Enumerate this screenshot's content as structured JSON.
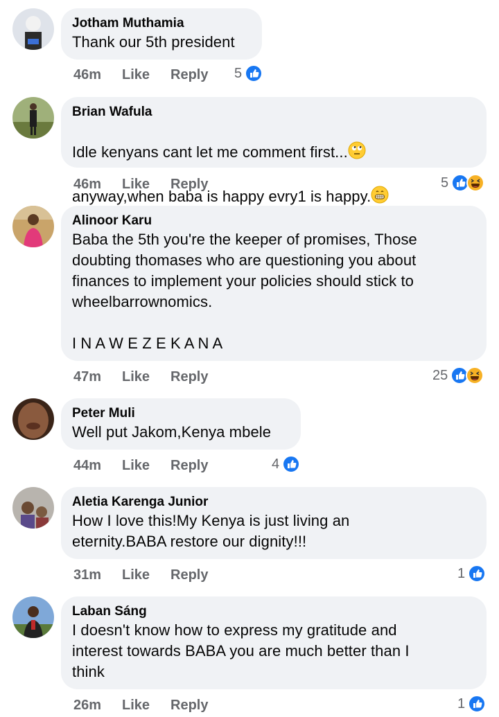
{
  "comments": [
    {
      "author": "Jotham Muthamia",
      "text": "Thank our 5th president",
      "time": "46m",
      "like_label": "Like",
      "reply_label": "Reply",
      "reactions": {
        "count": "5",
        "types": [
          "like"
        ]
      }
    },
    {
      "author": "Brian Wafula",
      "text_line1": "Idle kenyans cant let me comment first...",
      "text_line2": "anyway,when baba is happy evry1 is happy.",
      "emoji1": "face-with-rolling-eyes-icon",
      "emoji2": "grinning-face-icon",
      "time": "46m",
      "like_label": "Like",
      "reply_label": "Reply",
      "reactions": {
        "count": "5",
        "types": [
          "like",
          "haha"
        ]
      }
    },
    {
      "author": "Alinoor Karu",
      "text": "Baba the 5th you're the keeper of promises, Those\ndoubting thomases who are questioning you about\nfinances to implement your policies should stick to\nwheelbarrownomics.\n\nI N A W E Z E K A N A",
      "time": "47m",
      "like_label": "Like",
      "reply_label": "Reply",
      "reactions": {
        "count": "25",
        "types": [
          "like",
          "haha"
        ]
      }
    },
    {
      "author": "Peter Muli",
      "text": "Well put Jakom,Kenya mbele",
      "time": "44m",
      "like_label": "Like",
      "reply_label": "Reply",
      "reactions": {
        "count": "4",
        "types": [
          "like"
        ]
      }
    },
    {
      "author": "Aletia Karenga Junior",
      "text": "How I love this!My Kenya is just living an\neternity.BABA restore our dignity!!!",
      "time": "31m",
      "like_label": "Like",
      "reply_label": "Reply",
      "reactions": {
        "count": "1",
        "types": [
          "like"
        ]
      }
    },
    {
      "author": "Laban Sáng",
      "text": "I doesn't know how to express my gratitude and\ninterest towards BABA you are much better than I\nthink",
      "time": "26m",
      "like_label": "Like",
      "reply_label": "Reply",
      "reactions": {
        "count": "1",
        "types": [
          "like"
        ]
      }
    }
  ],
  "colors": {
    "like_blue": "#1877f2",
    "bubble_bg": "#f0f2f5",
    "meta_gray": "#65676b",
    "haha_yellow": "#f7b125"
  }
}
